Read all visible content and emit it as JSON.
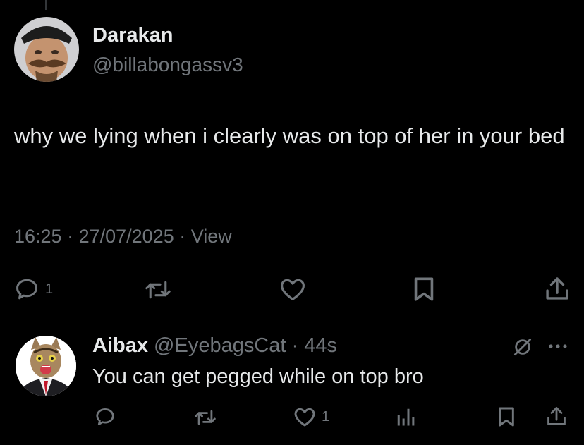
{
  "main_tweet": {
    "author_name": "Darakan",
    "author_handle": "@billabongassv3",
    "text": "why we lying when i clearly was on top of her in your bed",
    "time": "16:25",
    "date": "27/07/2025",
    "views_label": "View",
    "separator": " · ",
    "actions": {
      "reply_count": "1",
      "reply_icon": "reply-icon",
      "retweet_icon": "retweet-icon",
      "like_icon": "heart-icon",
      "bookmark_icon": "bookmark-icon",
      "share_icon": "share-icon"
    }
  },
  "reply": {
    "author_name": "Aibax",
    "author_handle": "@EyebagsCat",
    "age": "44s",
    "separator": " · ",
    "text": "You can get pegged while on top bro",
    "like_count": "1",
    "icons": [
      "grok-icon",
      "more-icon",
      "reply-icon",
      "retweet-icon",
      "heart-icon",
      "analytics-icon",
      "bookmark-icon",
      "share-icon"
    ]
  },
  "colors": {
    "background": "#000000",
    "primary_text": "#e7e9ea",
    "secondary_text": "#71767b",
    "divider": "#2f3336"
  }
}
